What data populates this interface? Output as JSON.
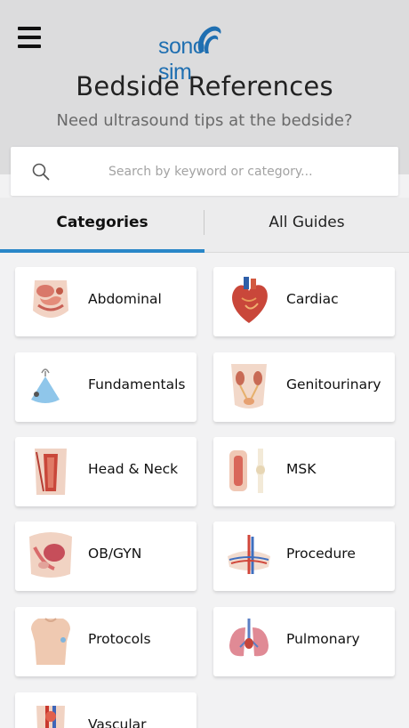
{
  "header": {
    "logo_text_left": "sono",
    "logo_text_right": "sim",
    "title": "Bedside References",
    "subtitle": "Need ultrasound tips at the bedside?"
  },
  "search": {
    "placeholder": "Search by keyword or category..."
  },
  "tabs": [
    {
      "label": "Categories",
      "active": true
    },
    {
      "label": "All Guides",
      "active": false
    }
  ],
  "categories": [
    {
      "label": "Abdominal",
      "icon": "abdominal-icon"
    },
    {
      "label": "Cardiac",
      "icon": "heart-icon"
    },
    {
      "label": "Fundamentals",
      "icon": "probe-icon"
    },
    {
      "label": "Genitourinary",
      "icon": "kidney-icon"
    },
    {
      "label": "Head & Neck",
      "icon": "neck-icon"
    },
    {
      "label": "MSK",
      "icon": "joint-icon"
    },
    {
      "label": "OB/GYN",
      "icon": "pelvis-icon"
    },
    {
      "label": "Procedure",
      "icon": "vessels-icon"
    },
    {
      "label": "Protocols",
      "icon": "torso-icon"
    },
    {
      "label": "Pulmonary",
      "icon": "lungs-icon"
    },
    {
      "label": "Vascular",
      "icon": "vascular-icon"
    }
  ],
  "colors": {
    "accent": "#2a87c8",
    "brand": "#1f6fb1",
    "header_bg": "#dcdcdd"
  }
}
